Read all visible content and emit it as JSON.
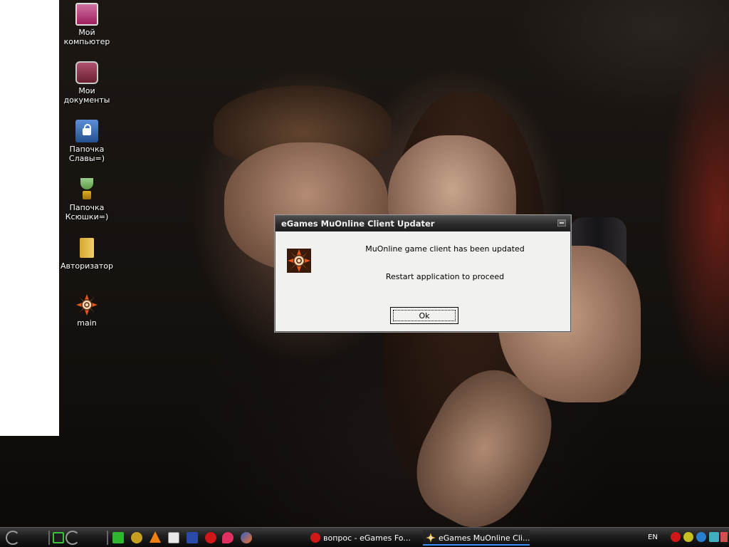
{
  "desktop": {
    "icons": [
      {
        "label": "Мой\nкомпьютер",
        "icon": "my-computer-icon"
      },
      {
        "label": "Мои\nдокументы",
        "icon": "my-documents-icon"
      },
      {
        "label": "Папочка\nСлавы=)",
        "icon": "locked-folder-icon"
      },
      {
        "label": "Папочка\nКсюшки=)",
        "icon": "trophy-icon"
      },
      {
        "label": "Авторизатор",
        "icon": "folder-icon"
      },
      {
        "label": "main",
        "icon": "mu-online-icon"
      }
    ]
  },
  "dialog": {
    "title": "eGames MuOnline Client Updater",
    "icon": "mu-online-icon",
    "message_line1": "MuOnline game client has been updated",
    "message_line2": "Restart application to proceed",
    "ok_prefix": "O",
    "ok_rest": "k"
  },
  "taskbar": {
    "quick_launch_icons": [
      "spinner-icon",
      "green-app-icon",
      "spinner-icon",
      "green-m-icon",
      "network-icon",
      "vlc-icon",
      "window-icon",
      "photo-icon",
      "opera-icon",
      "chat-icon",
      "firefox-icon"
    ],
    "tasks": [
      {
        "label": "вопрос - eGames Fo...",
        "icon": "opera-icon",
        "active": false
      },
      {
        "label": "eGames MuOnline Cli...",
        "icon": "mu-online-icon",
        "active": true
      }
    ],
    "language": "EN",
    "tray_icons": [
      "opera-icon",
      "sun-icon",
      "globe-icon",
      "network-icon",
      "arrow-icon"
    ]
  }
}
